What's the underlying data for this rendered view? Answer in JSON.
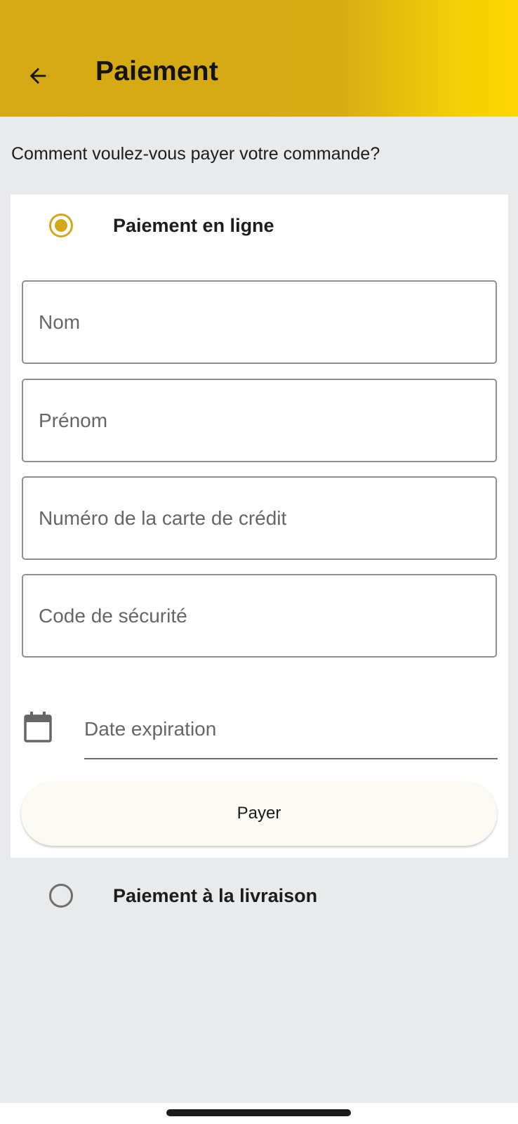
{
  "app_bar": {
    "title": "Paiement",
    "back_icon": "arrow-left-icon",
    "gradient_colors": [
      "#d4a913",
      "#ffd600"
    ]
  },
  "question": "Comment voulez-vous payer votre commande?",
  "payment_options": {
    "online": {
      "label": "Paiement en ligne",
      "selected": true,
      "fields": {
        "nom_placeholder": "Nom",
        "prenom_placeholder": "Prénom",
        "card_number_placeholder": "Numéro de la carte de crédit",
        "security_code_placeholder": "Code de sécurité",
        "expiration_placeholder": "Date expiration"
      },
      "calendar_icon": "calendar-icon",
      "pay_button_label": "Payer"
    },
    "cash_on_delivery": {
      "label": "Paiement à la livraison",
      "selected": false
    }
  },
  "colors": {
    "accent": "#d2a71a",
    "background": "#e9eaec"
  }
}
